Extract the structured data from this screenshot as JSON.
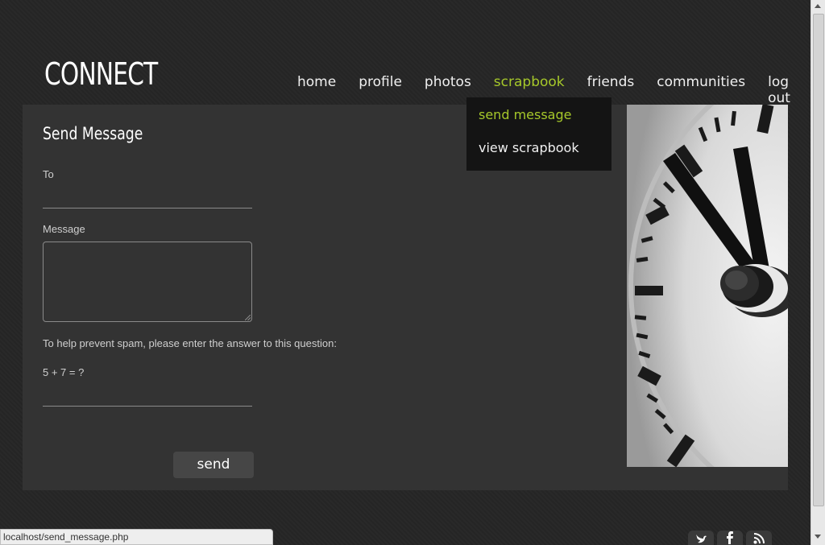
{
  "header": {
    "logo": "CONNECT"
  },
  "nav": {
    "items": [
      {
        "label": "home"
      },
      {
        "label": "profile"
      },
      {
        "label": "photos"
      },
      {
        "label": "scrapbook",
        "active": true
      },
      {
        "label": "friends"
      },
      {
        "label": "communities"
      },
      {
        "label": "log out"
      }
    ],
    "dropdown": [
      {
        "label": "send message",
        "active": true
      },
      {
        "label": "view scrapbook"
      }
    ]
  },
  "form": {
    "title": "Send Message",
    "to_label": "To",
    "to_value": "",
    "message_label": "Message",
    "message_value": "",
    "spam_prompt": "To help prevent spam, please enter the answer to this question:",
    "spam_question": "5 + 7 = ?",
    "spam_answer": "",
    "send_label": "send"
  },
  "status_bar": {
    "url": "localhost/send_message.php"
  },
  "footer": {
    "social_icons": [
      "twitter-icon",
      "facebook-icon",
      "rss-icon"
    ]
  },
  "colors": {
    "accent": "#a6c82a",
    "panel": "#333333",
    "dropdown": "#141414"
  }
}
